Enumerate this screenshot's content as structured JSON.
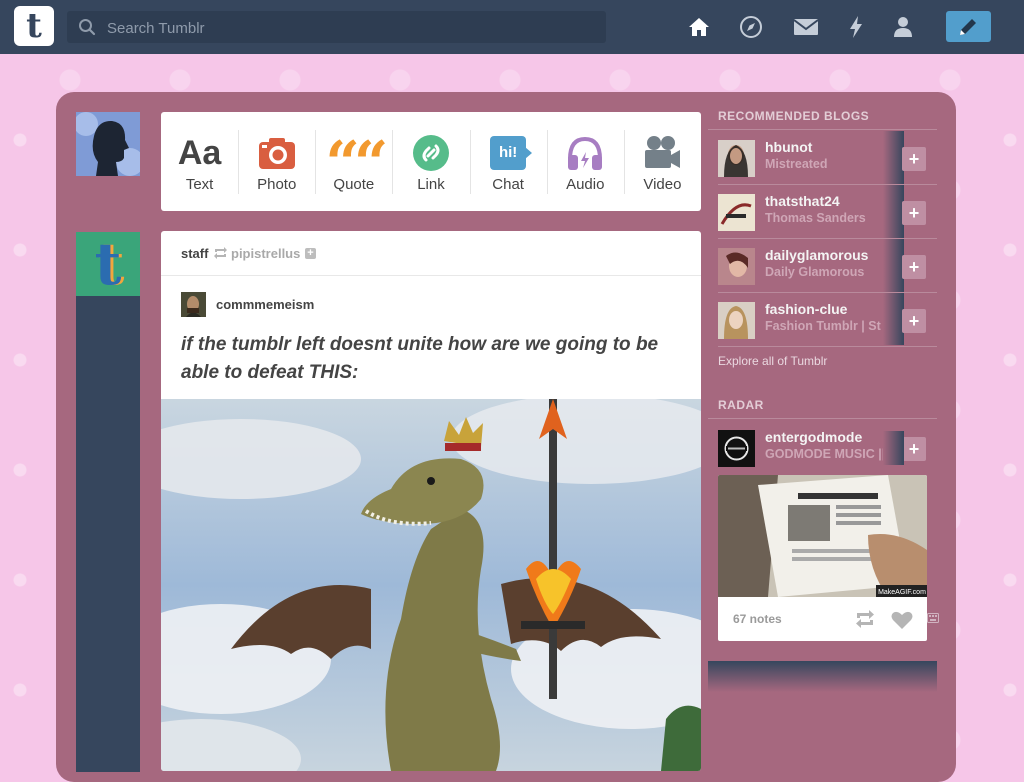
{
  "header": {
    "logo": "t",
    "search_placeholder": "Search Tumblr",
    "nav": [
      "home-icon",
      "explore-icon",
      "messages-icon",
      "activity-icon",
      "account-icon"
    ],
    "compose_icon": "pencil-icon"
  },
  "post_types": [
    {
      "label": "Text",
      "icon": "text-icon",
      "glyph": "Aa",
      "color": "#444444"
    },
    {
      "label": "Photo",
      "icon": "camera-icon",
      "color": "#d95e40"
    },
    {
      "label": "Quote",
      "icon": "quote-icon",
      "glyph": "““",
      "color": "#f2992e"
    },
    {
      "label": "Link",
      "icon": "link-icon",
      "color": "#56bc8a"
    },
    {
      "label": "Chat",
      "icon": "chat-icon",
      "glyph": "hi!",
      "color": "#529ecc"
    },
    {
      "label": "Audio",
      "icon": "headphones-icon",
      "color": "#a77dc2"
    },
    {
      "label": "Video",
      "icon": "video-camera-icon",
      "color": "#748089"
    }
  ],
  "post": {
    "reblogger": "staff",
    "reblogged_from": "pipistrellus",
    "original_author": "commmemeism",
    "text": "if the tumblr left doesnt unite how are we going to be able to defeat THIS:"
  },
  "sidebar": {
    "recommended_title": "RECOMMENDED BLOGS",
    "blogs": [
      {
        "name": "hbunot",
        "title": "Mistreated"
      },
      {
        "name": "thatsthat24",
        "title": "Thomas Sanders"
      },
      {
        "name": "dailyglamorous",
        "title": "Daily Glamorous"
      },
      {
        "name": "fashion-clue",
        "title": "Fashion Tumblr | St"
      }
    ],
    "explore_link": "Explore all of Tumblr",
    "radar_title": "RADAR",
    "radar": {
      "name": "entergodmode",
      "title": "GODMODE MUSIC || G",
      "notes": "67 notes",
      "watermark": "MakeAGIF.com"
    }
  },
  "colors": {
    "topbar": "#36465d",
    "panel": "#a6687f",
    "background": "#f6c6e8",
    "accent": "#529ecc"
  }
}
